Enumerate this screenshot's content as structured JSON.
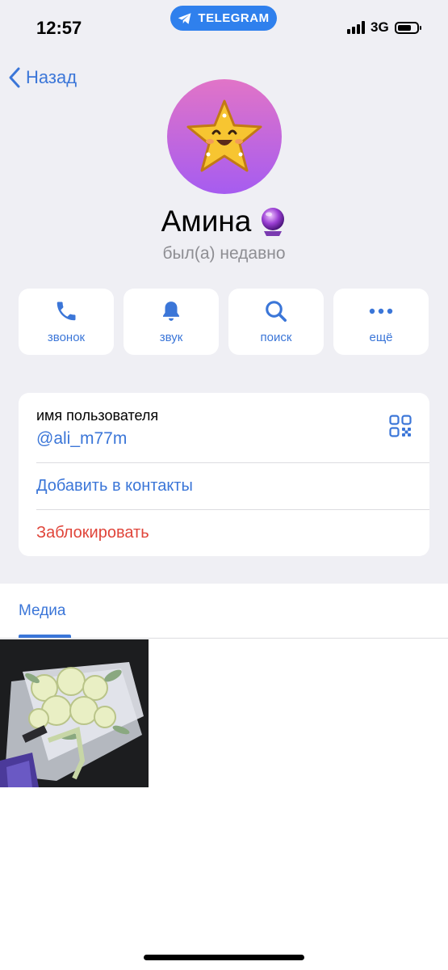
{
  "status_bar": {
    "time": "12:57",
    "app_pill": "TELEGRAM",
    "network": "3G"
  },
  "nav": {
    "back_label": "Назад"
  },
  "profile": {
    "name": "Амина",
    "status": "был(а) недавно"
  },
  "actions": [
    {
      "label": "звонок",
      "icon": "phone-icon"
    },
    {
      "label": "звук",
      "icon": "bell-icon"
    },
    {
      "label": "поиск",
      "icon": "search-icon"
    },
    {
      "label": "ещё",
      "icon": "more-icon"
    }
  ],
  "info": {
    "username_label": "имя пользователя",
    "username_value": "@ali_m77m",
    "add_contact": "Добавить в контакты",
    "block": "Заблокировать"
  },
  "media": {
    "tab_label": "Медиа"
  },
  "colors": {
    "accent": "#3b76d8",
    "danger": "#e0453a",
    "background": "#efeff4",
    "pill": "#2f80ed"
  }
}
